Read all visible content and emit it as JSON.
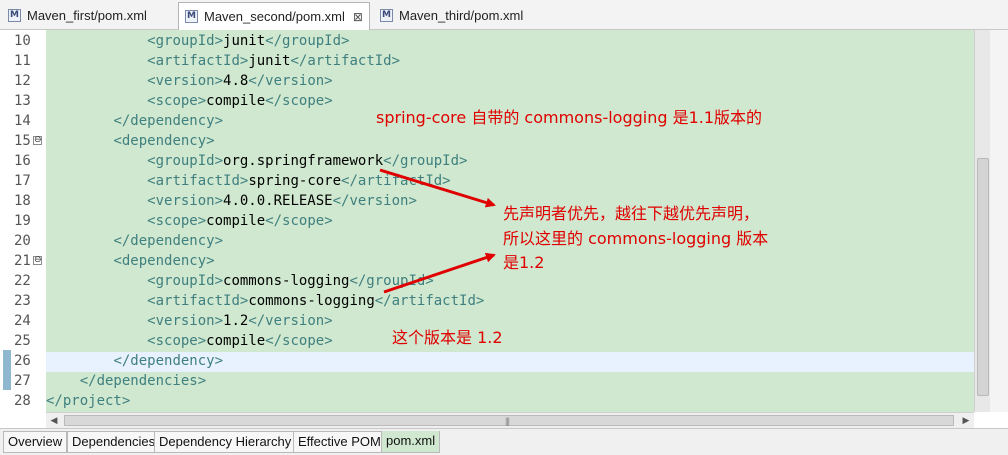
{
  "tabs": [
    {
      "label": "Maven_first/pom.xml",
      "active": false
    },
    {
      "label": "Maven_second/pom.xml",
      "active": true,
      "close": "⊠"
    },
    {
      "label": "Maven_third/pom.xml",
      "active": false
    }
  ],
  "tab_icon": "M",
  "code_lines": [
    {
      "num": "10",
      "fold": "",
      "parts": [
        [
          "            ",
          "txt"
        ],
        [
          "<groupId>",
          "tag"
        ],
        [
          "junit",
          "txt"
        ],
        [
          "</groupId>",
          "tag"
        ]
      ]
    },
    {
      "num": "11",
      "fold": "",
      "parts": [
        [
          "            ",
          "txt"
        ],
        [
          "<artifactId>",
          "tag"
        ],
        [
          "junit",
          "txt"
        ],
        [
          "</artifactId>",
          "tag"
        ]
      ]
    },
    {
      "num": "12",
      "fold": "",
      "parts": [
        [
          "            ",
          "txt"
        ],
        [
          "<version>",
          "tag"
        ],
        [
          "4.8",
          "txt"
        ],
        [
          "</version>",
          "tag"
        ]
      ]
    },
    {
      "num": "13",
      "fold": "",
      "parts": [
        [
          "            ",
          "txt"
        ],
        [
          "<scope>",
          "tag"
        ],
        [
          "compile",
          "txt"
        ],
        [
          "</scope>",
          "tag"
        ]
      ]
    },
    {
      "num": "14",
      "fold": "",
      "parts": [
        [
          "        ",
          "txt"
        ],
        [
          "</dependency>",
          "tag"
        ]
      ]
    },
    {
      "num": "15",
      "fold": "⊖",
      "parts": [
        [
          "        ",
          "txt"
        ],
        [
          "<dependency>",
          "tag"
        ]
      ]
    },
    {
      "num": "16",
      "fold": "",
      "parts": [
        [
          "            ",
          "txt"
        ],
        [
          "<groupId>",
          "tag"
        ],
        [
          "org.springframework",
          "txt"
        ],
        [
          "</groupId>",
          "tag"
        ]
      ]
    },
    {
      "num": "17",
      "fold": "",
      "parts": [
        [
          "            ",
          "txt"
        ],
        [
          "<artifactId>",
          "tag"
        ],
        [
          "spring-core",
          "txt"
        ],
        [
          "</artifactId>",
          "tag"
        ]
      ]
    },
    {
      "num": "18",
      "fold": "",
      "parts": [
        [
          "            ",
          "txt"
        ],
        [
          "<version>",
          "tag"
        ],
        [
          "4.0.0.RELEASE",
          "txt"
        ],
        [
          "</version>",
          "tag"
        ]
      ]
    },
    {
      "num": "19",
      "fold": "",
      "parts": [
        [
          "            ",
          "txt"
        ],
        [
          "<scope>",
          "tag"
        ],
        [
          "compile",
          "txt"
        ],
        [
          "</scope>",
          "tag"
        ]
      ]
    },
    {
      "num": "20",
      "fold": "",
      "parts": [
        [
          "        ",
          "txt"
        ],
        [
          "</dependency>",
          "tag"
        ]
      ]
    },
    {
      "num": "21",
      "fold": "⊖",
      "parts": [
        [
          "        ",
          "txt"
        ],
        [
          "<dependency>",
          "tag"
        ]
      ]
    },
    {
      "num": "22",
      "fold": "",
      "parts": [
        [
          "            ",
          "txt"
        ],
        [
          "<groupId>",
          "tag"
        ],
        [
          "commons-logging",
          "txt"
        ],
        [
          "</groupId>",
          "tag"
        ]
      ]
    },
    {
      "num": "23",
      "fold": "",
      "parts": [
        [
          "            ",
          "txt"
        ],
        [
          "<artifactId>",
          "tag"
        ],
        [
          "commons-logging",
          "txt"
        ],
        [
          "</artifactId>",
          "tag"
        ]
      ]
    },
    {
      "num": "24",
      "fold": "",
      "parts": [
        [
          "            ",
          "txt"
        ],
        [
          "<version>",
          "tag"
        ],
        [
          "1.2",
          "txt"
        ],
        [
          "</version>",
          "tag"
        ]
      ]
    },
    {
      "num": "25",
      "fold": "",
      "parts": [
        [
          "            ",
          "txt"
        ],
        [
          "<scope>",
          "tag"
        ],
        [
          "compile",
          "txt"
        ],
        [
          "</scope>",
          "tag"
        ]
      ]
    },
    {
      "num": "26",
      "fold": "",
      "parts": [
        [
          "        ",
          "txt"
        ],
        [
          "</dependency>",
          "tag"
        ]
      ]
    },
    {
      "num": "27",
      "fold": "",
      "parts": [
        [
          "    ",
          "txt"
        ],
        [
          "</dependencies>",
          "tag"
        ]
      ]
    },
    {
      "num": "28",
      "fold": "",
      "parts": [
        [
          "",
          "txt"
        ],
        [
          "</project>",
          "tag"
        ]
      ]
    }
  ],
  "annotations": {
    "note1": "spring-core 自带的 commons-logging 是1.1版本的",
    "note2_line1": "先声明者优先，越往下越优先声明，",
    "note2_line2": "所以这里的 commons-logging 版本",
    "note2_line3": "是1.2",
    "note3": "这个版本是 1.2"
  },
  "bottom_tabs": [
    {
      "label": "Overview",
      "active": false
    },
    {
      "label": "Dependencies",
      "active": false
    },
    {
      "label": "Dependency Hierarchy",
      "active": false
    },
    {
      "label": "Effective POM",
      "active": false
    },
    {
      "label": "pom.xml",
      "active": true
    }
  ],
  "scroll": {
    "left_arrow": "◀",
    "right_arrow": "▶",
    "grip": "|||"
  },
  "colors": {
    "editor_bg": "#cfe8cf",
    "tag": "#3f7f7f",
    "annotation": "#e00000",
    "current_line": "#e8f2fe"
  }
}
